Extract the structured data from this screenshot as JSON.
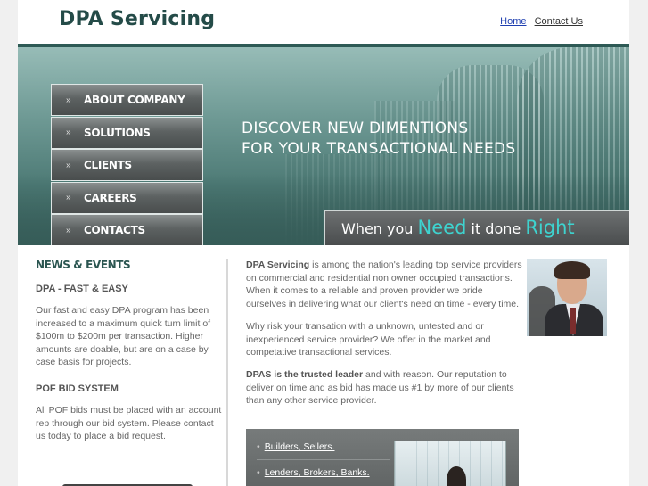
{
  "header": {
    "logo": "DPA Servicing",
    "nav": [
      {
        "label": "Home",
        "active": true
      },
      {
        "label": "Contact Us",
        "active": false
      }
    ]
  },
  "hero": {
    "menu": [
      {
        "label": "ABOUT COMPANY",
        "icon": "double-chevron-right-icon"
      },
      {
        "label": "SOLUTIONS",
        "icon": "double-chevron-right-icon"
      },
      {
        "label": "CLIENTS",
        "icon": "double-chevron-right-icon"
      },
      {
        "label": "CAREERS",
        "icon": "double-chevron-right-icon"
      },
      {
        "label": "CONTACTS",
        "icon": "double-chevron-right-icon"
      }
    ],
    "tagline_line1": "DISCOVER NEW DIMENTIONS",
    "tagline_line2": "FOR YOUR TRANSACTIONAL NEEDS",
    "slogan": {
      "p1": "When you ",
      "h1": "Need",
      "p2": " it done ",
      "h2": "Right"
    }
  },
  "news": {
    "heading": "NEWS & EVENTS",
    "item1_title": "DPA - FAST & EASY",
    "item1_body": "Our fast and easy DPA program has been increased to a maximum quick turn limit of $100m to $200m per transaction. Higher amounts are doable, but are on a case by case basis for projects.",
    "item2_title": "POF BID SYSTEM",
    "item2_body": "All POF bids must be placed with an account rep through our bid system. Please contact us today to place a bid request."
  },
  "main": {
    "p1_bold": "DPA Servicing",
    "p1_rest": " is among the nation's leading top service providers on commercial and residential non owner occupied transactions. When it comes to a reliable and proven provider we pride ourselves in delivering what our client's need on time - every time.",
    "p2": "Why risk your transation with a unknown, untested and or inexperienced service provider? We offer in the market and competative transactional services.",
    "p3_bold": "DPAS is the trusted leader",
    "p3_rest": " and with reason. Our reputation to deliver on time and as bid has made us #1 by more of our clients than any other service provider."
  },
  "links": {
    "items": [
      "Builders, Sellers.",
      "Lenders, Brokers, Banks."
    ],
    "bullet": "•"
  },
  "colors": {
    "brand": "#244b48",
    "accent": "#3ed3cf",
    "header_line": "#2e5a55"
  }
}
